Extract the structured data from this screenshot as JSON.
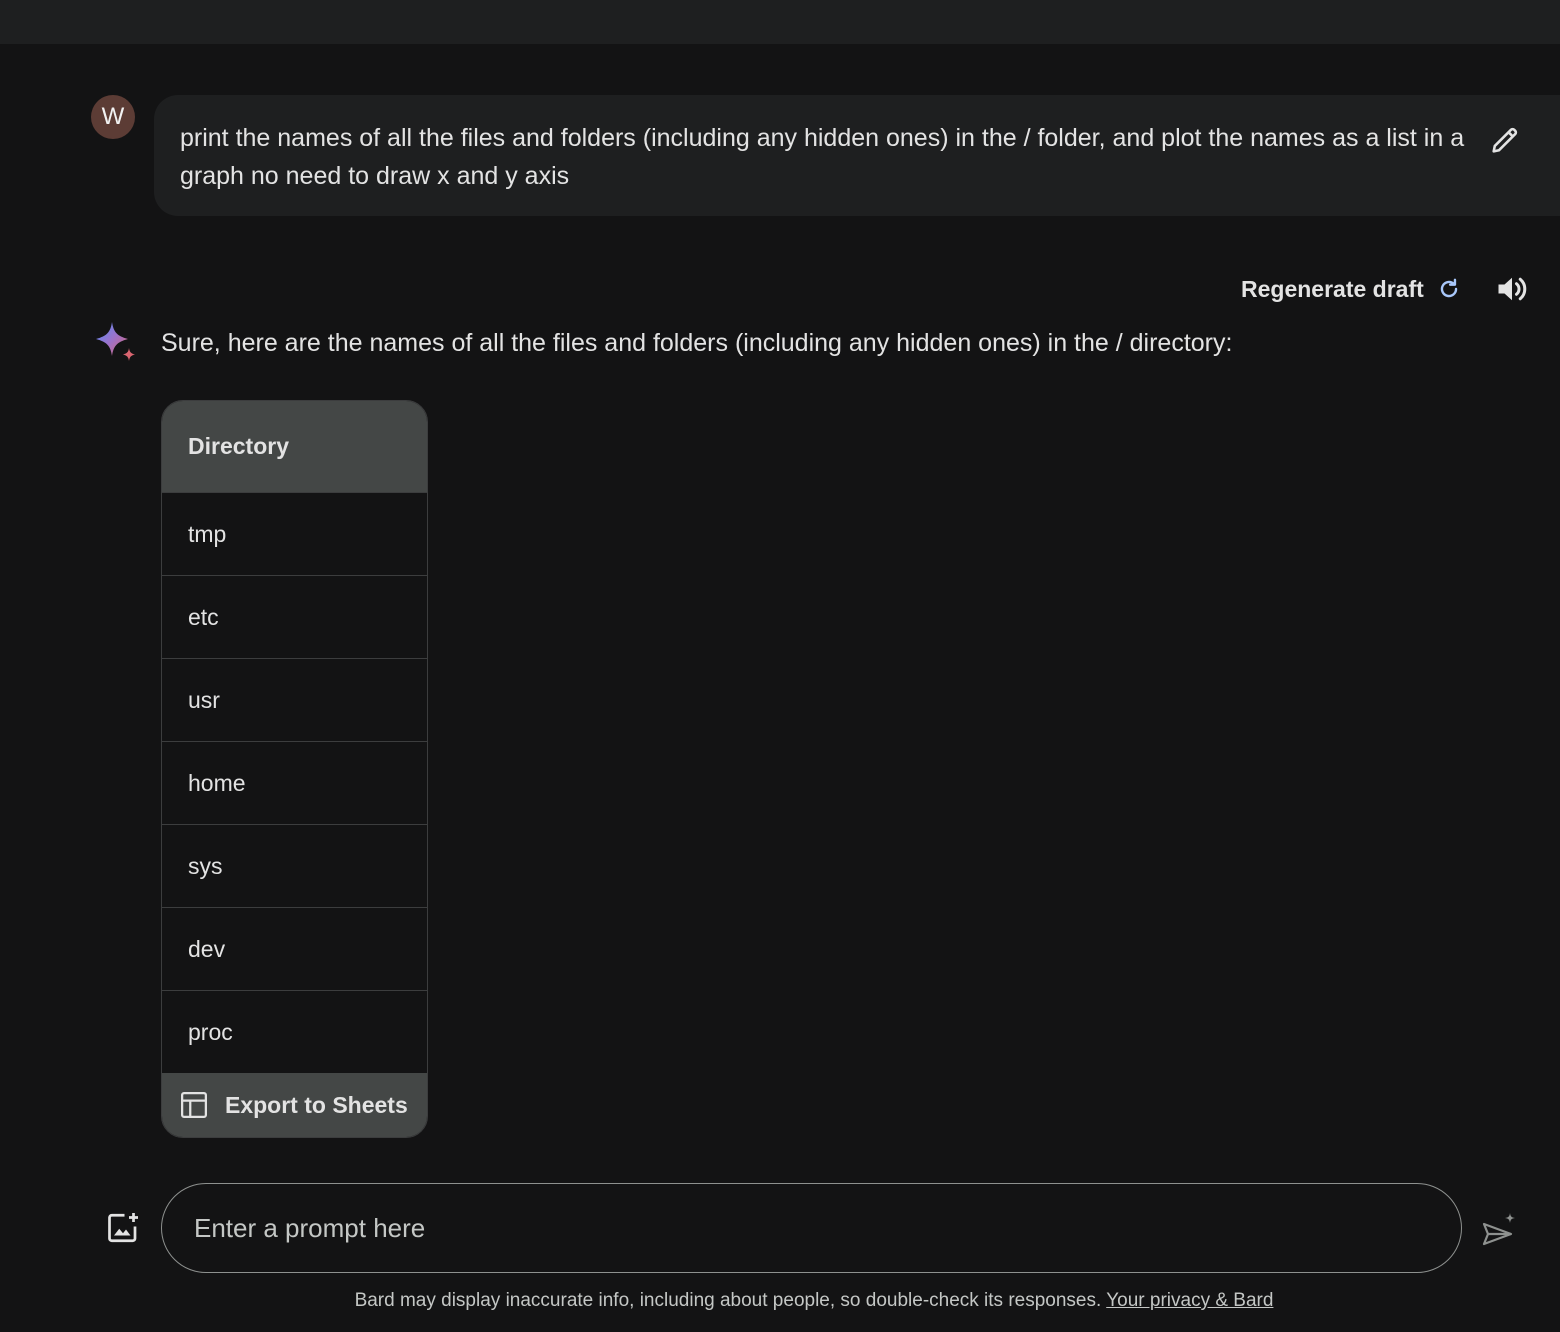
{
  "user": {
    "avatar_letter": "W",
    "message": "print the names of all the files and folders (including any hidden ones) in the / folder, and plot the names as a list in a graph no need to draw x and y axis"
  },
  "response_actions": {
    "regenerate_label": "Regenerate draft"
  },
  "response": {
    "text": "Sure, here are the names of all the files and folders (including any hidden ones) in the / directory:",
    "table": {
      "header": "Directory",
      "rows": [
        "tmp",
        "etc",
        "usr",
        "home",
        "sys",
        "dev",
        "proc"
      ]
    },
    "export_label": "Export to Sheets"
  },
  "composer": {
    "placeholder": "Enter a prompt here"
  },
  "footer": {
    "disclaimer": "Bard may display inaccurate info, including about people, so double-check its responses.",
    "privacy_link": "Your privacy & Bard"
  },
  "icons": [
    "edit-icon",
    "refresh-icon",
    "speaker-icon",
    "sparkle-icon",
    "sheets-icon",
    "image-upload-icon",
    "send-icon"
  ],
  "colors": {
    "background": "#131314",
    "surface": "#1e1f20",
    "table_header": "#444746",
    "avatar": "#5c3c35",
    "accent": "#a8c7fa"
  }
}
